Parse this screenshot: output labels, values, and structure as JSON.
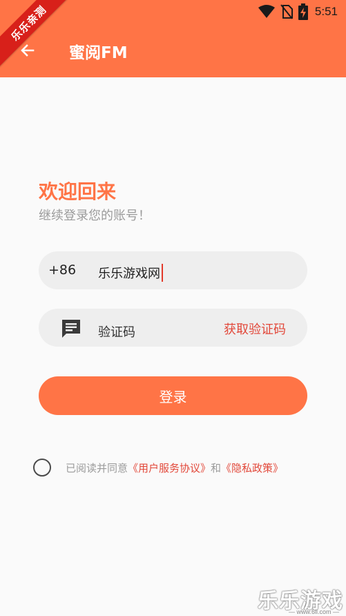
{
  "status_bar": {
    "time": "5:51",
    "icons": [
      "wifi-icon",
      "no-sim-icon",
      "battery-charging-icon"
    ]
  },
  "app_bar": {
    "back_icon": "arrow-left-icon",
    "title": "蜜阅FM"
  },
  "corner_ribbon": "乐乐亲测",
  "welcome": {
    "title": "欢迎回来",
    "subtitle": "继续登录您的账号！"
  },
  "phone_field": {
    "prefix": "+86",
    "value": "乐乐游戏网"
  },
  "code_field": {
    "icon": "message-icon",
    "placeholder": "验证码",
    "get_code_label": "获取验证码"
  },
  "login_button": "登录",
  "agreement": {
    "prefix": "已阅读并同意",
    "user_agreement": "《用户服务协议》",
    "and": "和",
    "privacy_policy": "《隐私政策》",
    "checked": false
  },
  "watermark": {
    "text": "乐乐游戏",
    "url": "— www.6ll.com —"
  },
  "colors": {
    "accent": "#ff7446",
    "link": "#e2483a",
    "background": "#fafafa",
    "field": "#eeeeee"
  }
}
